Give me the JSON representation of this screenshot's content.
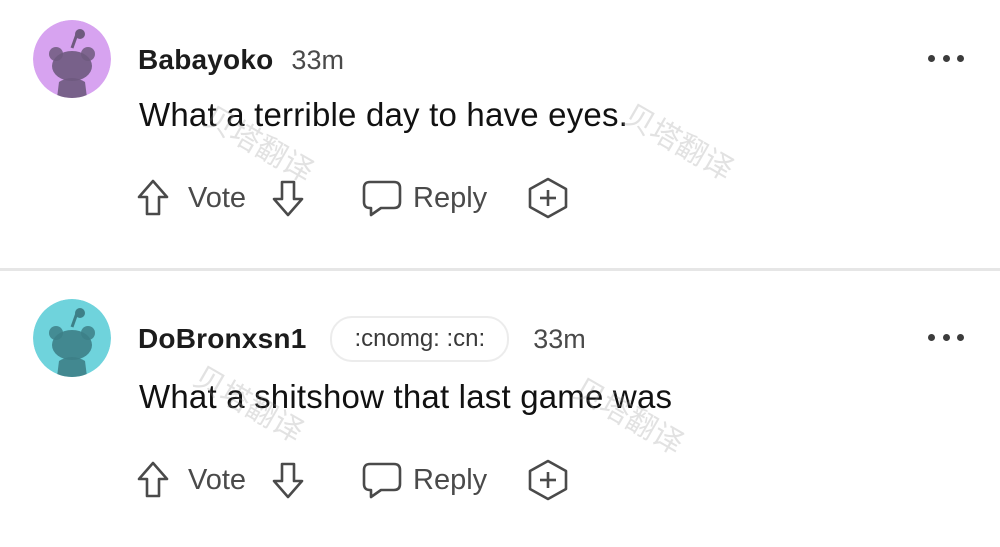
{
  "comments": [
    {
      "username": "Babayoko",
      "flair": "",
      "time": "33m",
      "body": "What a terrible day to have eyes.",
      "avatar_color": "#d7a3f0",
      "actions": {
        "vote_label": "Vote",
        "reply_label": "Reply"
      }
    },
    {
      "username": "DoBronxsn1",
      "flair": ":cnomg: :cn:",
      "time": "33m",
      "body": "What a shitshow that last game was",
      "avatar_color": "#6fd3dc",
      "actions": {
        "vote_label": "Vote",
        "reply_label": "Reply"
      }
    }
  ],
  "icons": {
    "upvote": "arrow-up-outline-icon",
    "downvote": "arrow-down-outline-icon",
    "reply": "speech-bubble-icon",
    "award": "add-award-icon",
    "more": "more-horizontal-icon",
    "avatar": "snoo-avatar-icon"
  },
  "colors": {
    "text_primary": "#1c1c1c",
    "text_secondary": "#4a4a4a",
    "divider": "#e6e6e6"
  },
  "watermark_text": "贝塔翻译"
}
